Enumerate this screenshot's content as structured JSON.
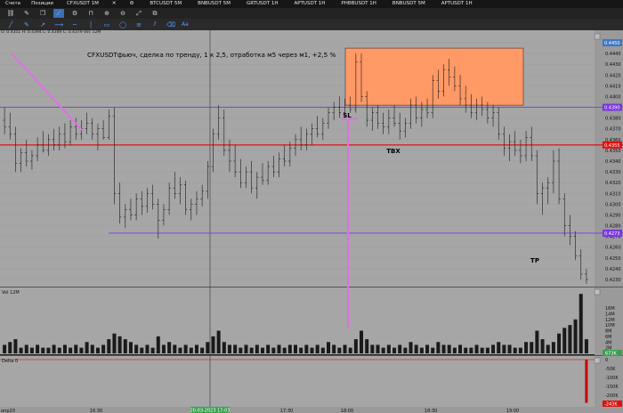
{
  "tabs": [
    {
      "label": "Счета"
    },
    {
      "label": "Позиции"
    },
    {
      "label": "CFXUSDT 1M",
      "close": "✕"
    },
    {
      "label": "⚙"
    },
    {
      "label": "BTCUSDT 5M"
    },
    {
      "label": "BNBUSDT 5M"
    },
    {
      "label": "GRTUSDT 1H"
    },
    {
      "label": "APTUSDT 1H"
    },
    {
      "label": "PHBBUSDT 1H"
    },
    {
      "label": "BNBUSDT 5M"
    },
    {
      "label": "APTUSDT 1H"
    }
  ],
  "toolbar": {
    "icons": [
      "link-icon",
      "eyedropper-icon",
      "copy-icon",
      "line-tool-icon",
      "gear-icon",
      "magnet-icon",
      "zoom-in-icon",
      "zoom-out-icon",
      "maximize-icon",
      "crop-icon"
    ]
  },
  "drawing_toolbar": {
    "icons": [
      "cursor-icon",
      "pencil-icon",
      "trendline-icon",
      "ray-icon",
      "horizontal-line-icon",
      "vertical-line-icon",
      "rectangle-icon",
      "ellipse-icon",
      "fibonacci-icon",
      "channel-icon",
      "clear-icon"
    ],
    "text_tool": "Aa"
  },
  "ohlc": "O: 0.4351  H: 0.4394  L: 0.4349  C: 0.4379  Vol: 12M",
  "annotation": "CFXUSDTфьюч, сделка по тренду, 1 к 2,5,  отработка м5 через м1, +2,5 %",
  "labels": {
    "sl": "SL",
    "tbx": "TBX",
    "tp": "TP"
  },
  "price_axis": {
    "ticks": [
      "0.4450",
      "0.4440",
      "0.4430",
      "0.4420",
      "0.4410",
      "0.4400",
      "0.4390",
      "0.4380",
      "0.4370",
      "0.4360",
      "0.4350",
      "0.4340",
      "0.4330",
      "0.4320",
      "0.4310",
      "0.4300",
      "0.4290",
      "0.4280",
      "0.4270",
      "0.4260",
      "0.4250",
      "0.4240",
      "0.4230"
    ],
    "badges": {
      "top": "0.4450",
      "resistance": "0.4390",
      "entry": "0.4355",
      "support": "0.4273"
    }
  },
  "volume_panel": {
    "title": "Vol 12M",
    "ticks": [
      "16M",
      "14M",
      "12M",
      "10M",
      "8M",
      "6M",
      "4M",
      "2M"
    ],
    "badge": "673K"
  },
  "delta_panel": {
    "title": "Delta 0",
    "ticks": [
      "0",
      "-50K",
      "-100K",
      "-150K",
      "-200K"
    ],
    "badge": "-243K"
  },
  "time_axis": {
    "labels": [
      "16:30",
      "17:30",
      "18:00",
      "18:30",
      "19:00"
    ],
    "left_label": "апр20",
    "cursor_label": "20-03-2023 17:03"
  },
  "colors": {
    "chart_bg": "#a6a6a6",
    "red_line": "#e01010",
    "purple_line": "#7a35e0",
    "pink_trend": "#e070e0",
    "box_fill": "#ff9966",
    "badge_red": "#e01010",
    "badge_purple": "#7a35e0",
    "badge_green": "#3aa050"
  },
  "chart_data": {
    "type": "ohlc",
    "price_range": [
      0.4225,
      0.4455
    ],
    "levels": {
      "resistance": 0.439,
      "entry": 0.4355,
      "support": 0.4273
    },
    "box": {
      "low": 0.4392,
      "high": 0.4445
    },
    "candles": [
      [
        0.4378,
        0.439,
        0.4365,
        0.4372
      ],
      [
        0.4372,
        0.4385,
        0.436,
        0.4365
      ],
      [
        0.4365,
        0.4372,
        0.433,
        0.4338
      ],
      [
        0.4338,
        0.4352,
        0.433,
        0.4348
      ],
      [
        0.4348,
        0.436,
        0.4335,
        0.434
      ],
      [
        0.434,
        0.435,
        0.4332,
        0.4345
      ],
      [
        0.4345,
        0.4362,
        0.434,
        0.4355
      ],
      [
        0.4355,
        0.4368,
        0.4348,
        0.435
      ],
      [
        0.435,
        0.4365,
        0.4345,
        0.436
      ],
      [
        0.436,
        0.437,
        0.435,
        0.4355
      ],
      [
        0.4355,
        0.4372,
        0.435,
        0.4365
      ],
      [
        0.4365,
        0.4375,
        0.4352,
        0.4358
      ],
      [
        0.4358,
        0.4378,
        0.4355,
        0.4372
      ],
      [
        0.4372,
        0.438,
        0.436,
        0.4365
      ],
      [
        0.4365,
        0.4378,
        0.436,
        0.437
      ],
      [
        0.437,
        0.4385,
        0.4365,
        0.4375
      ],
      [
        0.4375,
        0.438,
        0.436,
        0.4365
      ],
      [
        0.4365,
        0.4375,
        0.435,
        0.437
      ],
      [
        0.437,
        0.4378,
        0.436,
        0.4362
      ],
      [
        0.4362,
        0.4388,
        0.436,
        0.4382
      ],
      [
        0.4382,
        0.439,
        0.43,
        0.431
      ],
      [
        0.431,
        0.432,
        0.4282,
        0.4288
      ],
      [
        0.4288,
        0.43,
        0.4278,
        0.4295
      ],
      [
        0.4295,
        0.4305,
        0.4285,
        0.429
      ],
      [
        0.429,
        0.431,
        0.4285,
        0.4305
      ],
      [
        0.4305,
        0.4312,
        0.429,
        0.4298
      ],
      [
        0.4298,
        0.4315,
        0.4292,
        0.431
      ],
      [
        0.431,
        0.4318,
        0.4295,
        0.43
      ],
      [
        0.43,
        0.4305,
        0.4268,
        0.4285
      ],
      [
        0.4285,
        0.43,
        0.428,
        0.4295
      ],
      [
        0.4295,
        0.432,
        0.429,
        0.4315
      ],
      [
        0.4315,
        0.433,
        0.4305,
        0.431
      ],
      [
        0.431,
        0.4325,
        0.43,
        0.4318
      ],
      [
        0.4318,
        0.4322,
        0.429,
        0.4295
      ],
      [
        0.4295,
        0.4305,
        0.4285,
        0.43
      ],
      [
        0.43,
        0.4312,
        0.429,
        0.4305
      ],
      [
        0.4305,
        0.4318,
        0.4298,
        0.4312
      ],
      [
        0.4312,
        0.434,
        0.4305,
        0.4335
      ],
      [
        0.4335,
        0.437,
        0.433,
        0.4365
      ],
      [
        0.4365,
        0.4392,
        0.436,
        0.438
      ],
      [
        0.438,
        0.4388,
        0.4345,
        0.435
      ],
      [
        0.435,
        0.436,
        0.433,
        0.434
      ],
      [
        0.434,
        0.4355,
        0.4325,
        0.433
      ],
      [
        0.433,
        0.4342,
        0.4315,
        0.432
      ],
      [
        0.432,
        0.4335,
        0.4315,
        0.433
      ],
      [
        0.433,
        0.434,
        0.431,
        0.4315
      ],
      [
        0.4315,
        0.433,
        0.4305,
        0.4325
      ],
      [
        0.4325,
        0.4338,
        0.4318,
        0.4322
      ],
      [
        0.4322,
        0.434,
        0.4318,
        0.4335
      ],
      [
        0.4335,
        0.4345,
        0.4325,
        0.433
      ],
      [
        0.433,
        0.4348,
        0.4325,
        0.4342
      ],
      [
        0.4342,
        0.4355,
        0.4335,
        0.434
      ],
      [
        0.434,
        0.4358,
        0.4335,
        0.4352
      ],
      [
        0.4352,
        0.4365,
        0.4345,
        0.436
      ],
      [
        0.436,
        0.4372,
        0.435,
        0.4355
      ],
      [
        0.4355,
        0.437,
        0.435,
        0.4365
      ],
      [
        0.4365,
        0.4375,
        0.4355,
        0.437
      ],
      [
        0.437,
        0.4382,
        0.4362,
        0.4365
      ],
      [
        0.4365,
        0.438,
        0.436,
        0.4375
      ],
      [
        0.4375,
        0.439,
        0.437,
        0.4385
      ],
      [
        0.4385,
        0.4395,
        0.4378,
        0.439
      ],
      [
        0.439,
        0.44,
        0.438,
        0.4385
      ],
      [
        0.4385,
        0.4398,
        0.438,
        0.4392
      ],
      [
        0.4392,
        0.44,
        0.4385,
        0.4388
      ],
      [
        0.4388,
        0.444,
        0.4385,
        0.4432
      ],
      [
        0.4432,
        0.444,
        0.4395,
        0.44
      ],
      [
        0.44,
        0.4405,
        0.4372,
        0.4378
      ],
      [
        0.4378,
        0.439,
        0.4368,
        0.4385
      ],
      [
        0.4385,
        0.4392,
        0.437,
        0.4375
      ],
      [
        0.4375,
        0.4385,
        0.4365,
        0.4372
      ],
      [
        0.4372,
        0.4388,
        0.4365,
        0.438
      ],
      [
        0.438,
        0.4392,
        0.4372,
        0.4375
      ],
      [
        0.4375,
        0.4385,
        0.436,
        0.4368
      ],
      [
        0.4368,
        0.438,
        0.4362,
        0.4375
      ],
      [
        0.4375,
        0.4398,
        0.437,
        0.4392
      ],
      [
        0.4392,
        0.44,
        0.4375,
        0.438
      ],
      [
        0.438,
        0.4395,
        0.4372,
        0.4388
      ],
      [
        0.4388,
        0.4398,
        0.438,
        0.4385
      ],
      [
        0.4385,
        0.442,
        0.438,
        0.4415
      ],
      [
        0.4415,
        0.4425,
        0.4398,
        0.4405
      ],
      [
        0.4405,
        0.443,
        0.44,
        0.4425
      ],
      [
        0.4425,
        0.4435,
        0.441,
        0.4418
      ],
      [
        0.4418,
        0.4428,
        0.4405,
        0.441
      ],
      [
        0.441,
        0.442,
        0.4392,
        0.4398
      ],
      [
        0.4398,
        0.441,
        0.4385,
        0.4392
      ],
      [
        0.4392,
        0.4402,
        0.438,
        0.4385
      ],
      [
        0.4385,
        0.4398,
        0.4378,
        0.4392
      ],
      [
        0.4392,
        0.44,
        0.4382,
        0.4388
      ],
      [
        0.4388,
        0.4395,
        0.4375,
        0.438
      ],
      [
        0.438,
        0.4392,
        0.4372,
        0.4385
      ],
      [
        0.4385,
        0.439,
        0.436,
        0.4365
      ],
      [
        0.4365,
        0.4372,
        0.4345,
        0.4352
      ],
      [
        0.4352,
        0.4365,
        0.434,
        0.4358
      ],
      [
        0.4358,
        0.4368,
        0.4345,
        0.435
      ],
      [
        0.435,
        0.436,
        0.4338,
        0.4345
      ],
      [
        0.4345,
        0.4368,
        0.434,
        0.4362
      ],
      [
        0.4362,
        0.4372,
        0.434,
        0.4345
      ],
      [
        0.4345,
        0.435,
        0.43,
        0.431
      ],
      [
        0.431,
        0.432,
        0.429,
        0.4315
      ],
      [
        0.4315,
        0.4325,
        0.43,
        0.432
      ],
      [
        0.432,
        0.435,
        0.431,
        0.434
      ],
      [
        0.434,
        0.4352,
        0.43,
        0.4305
      ],
      [
        0.4305,
        0.431,
        0.427,
        0.428
      ],
      [
        0.428,
        0.429,
        0.4262,
        0.427
      ],
      [
        0.427,
        0.4275,
        0.4248,
        0.4252
      ],
      [
        0.4252,
        0.4258,
        0.423,
        0.4235
      ],
      [
        0.4235,
        0.424,
        0.4226,
        0.423
      ]
    ],
    "volume_millions": [
      3,
      4,
      5,
      2,
      3,
      2,
      3,
      2,
      2,
      3,
      2,
      3,
      2,
      3,
      2,
      4,
      3,
      2,
      3,
      5,
      7,
      6,
      5,
      4,
      3,
      2,
      3,
      2,
      6,
      3,
      4,
      3,
      2,
      3,
      2,
      3,
      2,
      4,
      6,
      8,
      4,
      3,
      3,
      2,
      3,
      2,
      3,
      2,
      3,
      2,
      3,
      2,
      3,
      3,
      2,
      3,
      2,
      3,
      2,
      4,
      3,
      2,
      3,
      2,
      5,
      8,
      5,
      3,
      3,
      2,
      3,
      2,
      3,
      2,
      4,
      3,
      2,
      3,
      2,
      4,
      3,
      3,
      2,
      3,
      2,
      2,
      3,
      2,
      2,
      3,
      4,
      3,
      3,
      2,
      2,
      4,
      4,
      8,
      5,
      3,
      4,
      7,
      9,
      10,
      12,
      21,
      5
    ],
    "delta_thousands": [
      0,
      0,
      0,
      0,
      0,
      0,
      0,
      0,
      0,
      0,
      0,
      0,
      0,
      0,
      0,
      0,
      0,
      0,
      0,
      0,
      0,
      0,
      0,
      0,
      0,
      0,
      0,
      0,
      0,
      0,
      0,
      0,
      0,
      0,
      0,
      0,
      0,
      0,
      0,
      0,
      0,
      0,
      0,
      0,
      0,
      0,
      0,
      0,
      0,
      0,
      0,
      0,
      0,
      0,
      0,
      0,
      0,
      0,
      0,
      0,
      0,
      0,
      0,
      0,
      0,
      0,
      0,
      0,
      0,
      0,
      0,
      0,
      0,
      0,
      0,
      0,
      0,
      0,
      0,
      0,
      0,
      0,
      0,
      0,
      0,
      0,
      0,
      0,
      0,
      0,
      0,
      0,
      0,
      0,
      0,
      0,
      0,
      0,
      0,
      0,
      0,
      0,
      0,
      0,
      0,
      0,
      -243
    ]
  }
}
